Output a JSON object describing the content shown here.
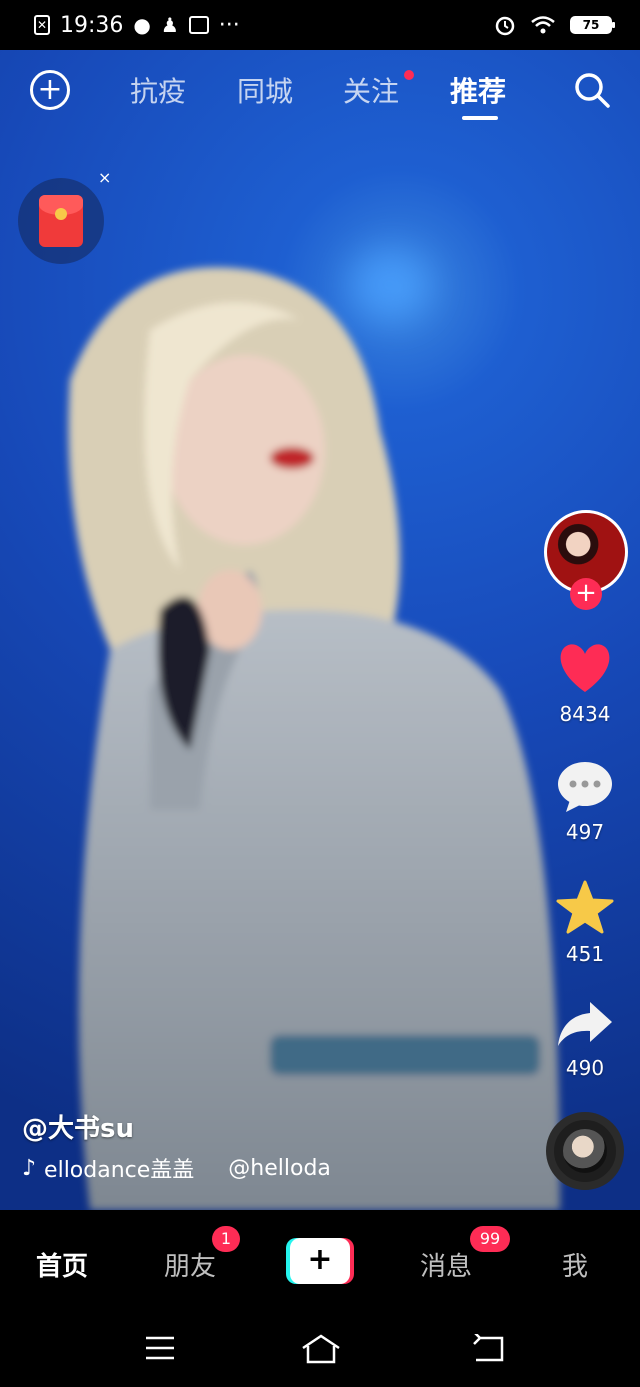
{
  "status_bar": {
    "time": "19:36",
    "more": "···",
    "battery": "75"
  },
  "top_nav": {
    "tabs": [
      "抗疫",
      "同城",
      "关注",
      "推荐"
    ],
    "active_tab": "推荐"
  },
  "red_packet": {
    "close": "×"
  },
  "actions": {
    "follow": "+",
    "likes": "8434",
    "comments": "497",
    "favorites": "451",
    "shares": "490"
  },
  "video_info": {
    "author": "@大书su",
    "music": "ellodance盖盖",
    "music_author": "@helloda"
  },
  "bottom_tabs": {
    "home": "首页",
    "friends": "朋友",
    "friends_badge": "1",
    "create": "+",
    "messages": "消息",
    "messages_badge": "99",
    "me": "我"
  },
  "colors": {
    "accent_red": "#fe2c55",
    "accent_cyan": "#25f4ee",
    "video_bg": "#1e5fd1",
    "star": "#f7c948"
  }
}
